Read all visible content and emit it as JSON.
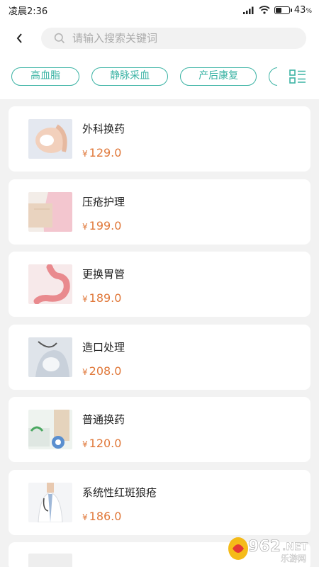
{
  "status": {
    "time": "凌晨2:36",
    "battery": "43"
  },
  "search": {
    "placeholder": "请输入搜索关键词"
  },
  "tags": [
    "高血脂",
    "静脉采血",
    "产后康复",
    "复"
  ],
  "products": [
    {
      "name": "外科换药",
      "currency": "¥",
      "price": "129.0"
    },
    {
      "name": "压疮护理",
      "currency": "¥",
      "price": "199.0"
    },
    {
      "name": "更换胃管",
      "currency": "¥",
      "price": "189.0"
    },
    {
      "name": "造口处理",
      "currency": "¥",
      "price": "208.0"
    },
    {
      "name": "普通换药",
      "currency": "¥",
      "price": "120.0"
    },
    {
      "name": "系统性红斑狼疮",
      "currency": "¥",
      "price": "186.0"
    }
  ],
  "watermark": {
    "number": "962",
    "suffix": ".NET",
    "cn": "乐游网"
  },
  "colors": {
    "accent": "#3bb3a4",
    "price": "#e0783a"
  },
  "icons": {
    "back": "back-arrow-icon",
    "search": "search-icon",
    "layout": "grid-list-icon"
  }
}
